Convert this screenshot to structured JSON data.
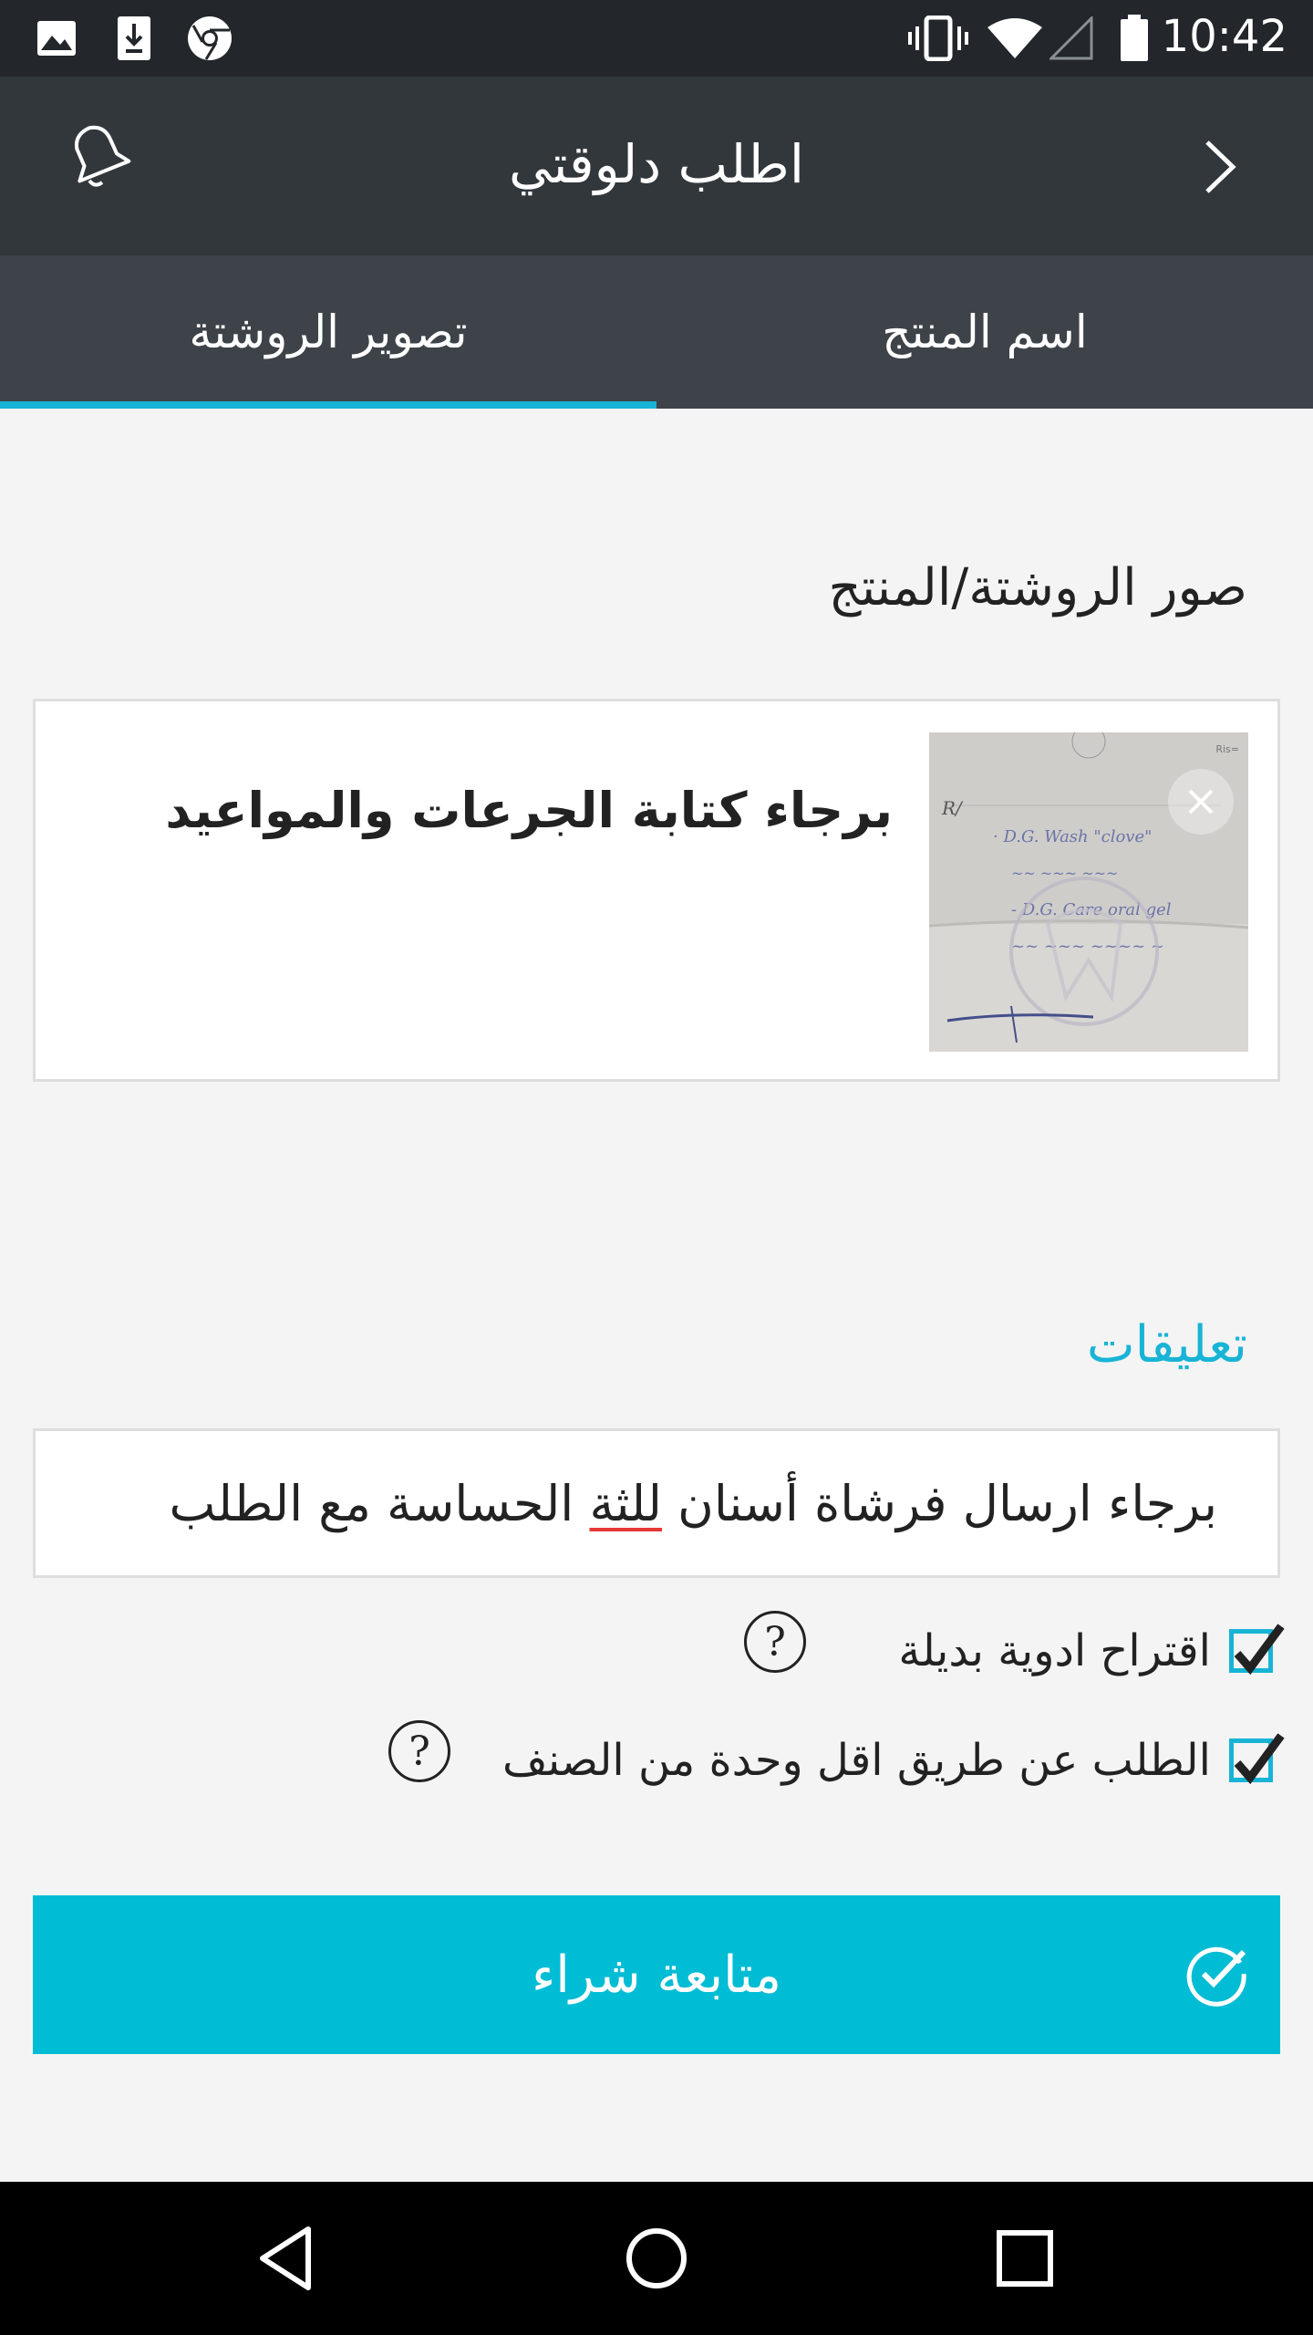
{
  "status_bar": {
    "time": "10:42",
    "icons": [
      "gallery-icon",
      "download-icon",
      "chrome-icon",
      "vibrate-icon",
      "wifi-icon",
      "signal-icon",
      "battery-icon"
    ]
  },
  "app_bar": {
    "title": "اطلب دلوقتي",
    "left_icon": "bell-icon",
    "right_icon": "chevron-right-icon"
  },
  "tabs": [
    {
      "label": "اسم المنتج",
      "active": false
    },
    {
      "label": "تصوير الروشتة",
      "active": true
    }
  ],
  "photos_section": {
    "title": "صور الروشتة/المنتج",
    "caption": "برجاء كتابة الجرعات والمواعيد"
  },
  "comments": {
    "label": "تعليقات",
    "text_before": "برجاء ارسال فرشاة أسنان ",
    "text_misspelled": "للثة",
    "text_after": " الحساسة مع الطلب"
  },
  "options": [
    {
      "label": "اقتراح ادوية بديلة",
      "checked": true
    },
    {
      "label": "الطلب عن طريق اقل وحدة من الصنف",
      "checked": true
    }
  ],
  "help_glyph": "?",
  "buy_button": {
    "label": "متابعة شراء"
  },
  "colors": {
    "accent": "#00bcd4",
    "app_bar": "#32373c",
    "tab_bar": "#3d4348",
    "status_bar": "#23272b"
  }
}
